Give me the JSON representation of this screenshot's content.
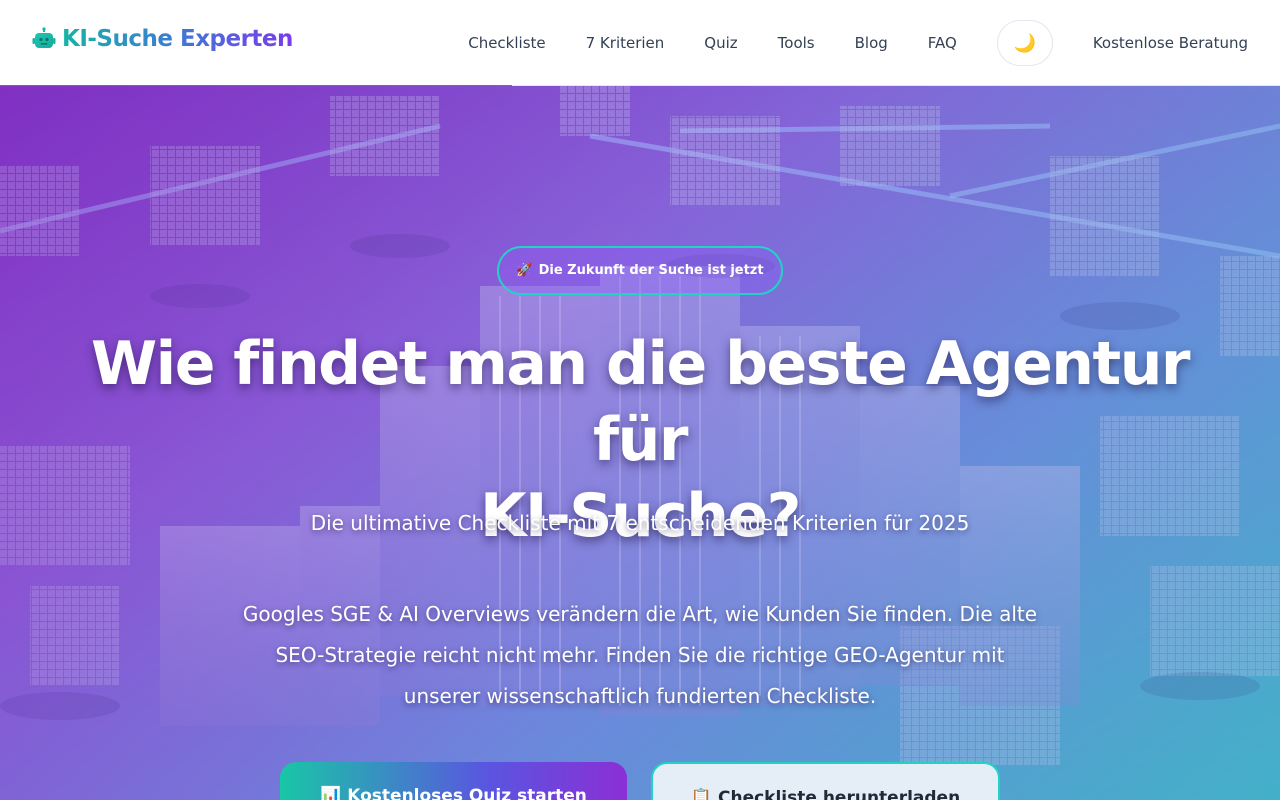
{
  "brand": {
    "name": "KI-Suche Experten",
    "icon": "robot-icon"
  },
  "nav": {
    "links": [
      "Checkliste",
      "7 Kriterien",
      "Quiz",
      "Tools",
      "Blog",
      "FAQ"
    ],
    "theme_toggle_icon": "🌙",
    "cta": "Kostenlose Beratung"
  },
  "hero": {
    "badge_icon": "🚀",
    "badge_text": "Die Zukunft der Suche ist jetzt",
    "headline_line1": "Wie findet man die beste Agentur für",
    "headline_line2": "KI-Suche?",
    "subheadline": "Die ultimative Checkliste mit 7 entscheidenden Kriterien für 2025",
    "description_line1": "Googles SGE & AI Overviews verändern die Art, wie Kunden Sie finden. Die alte",
    "description_line2": "SEO-Strategie reicht nicht mehr. Finden Sie die richtige GEO-Agentur mit",
    "description_line3": "unserer wissenschaftlich fundierten Checkliste.",
    "primary_button_icon": "📊",
    "primary_button": "Kostenloses Quiz starten",
    "secondary_button_icon": "📋",
    "secondary_button": "Checkliste herunterladen"
  },
  "colors": {
    "accent_teal": "#22d3c5",
    "accent_purple": "#7c3aed",
    "nav_text": "#334155"
  }
}
